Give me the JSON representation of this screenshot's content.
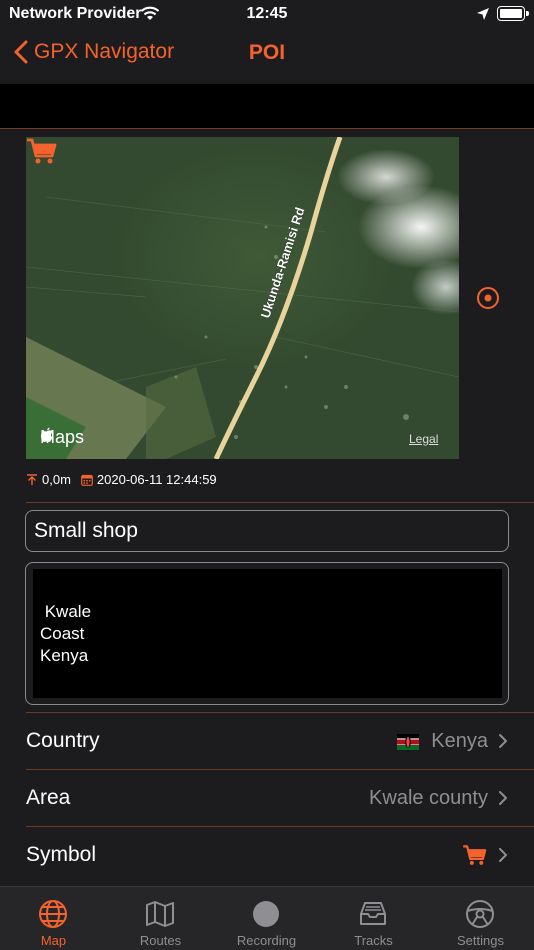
{
  "status_bar": {
    "carrier": "Network Provider",
    "time": "12:45",
    "icons": [
      "wifi-icon",
      "location-arrow-icon",
      "battery-icon"
    ]
  },
  "nav": {
    "back_label": "GPX Navigator",
    "title": "POI"
  },
  "map": {
    "road_label": "Ukunda-Ramisi Rd",
    "logo_text": "Maps",
    "legal_label": "Legal",
    "pin_icon": "shopping-cart-icon"
  },
  "meta": {
    "elevation": "0,0m",
    "timestamp": "2020-06-11 12:44:59"
  },
  "poi": {
    "name": "Small shop",
    "description": " Kwale\nCoast\nKenya"
  },
  "rows": {
    "country": {
      "label": "Country",
      "value": "Kenya",
      "icon": "kenya-flag-icon"
    },
    "area": {
      "label": "Area",
      "value": "Kwale county"
    },
    "symbol": {
      "label": "Symbol",
      "icon": "shopping-cart-icon"
    }
  },
  "tabs": [
    {
      "label": "Map",
      "icon": "globe-icon",
      "active": true
    },
    {
      "label": "Routes",
      "icon": "map-icon",
      "active": false
    },
    {
      "label": "Recording",
      "icon": "record-icon",
      "active": false
    },
    {
      "label": "Tracks",
      "icon": "inbox-icon",
      "active": false
    },
    {
      "label": "Settings",
      "icon": "steering-wheel-icon",
      "active": false
    }
  ],
  "colors": {
    "accent": "#f4622d",
    "background": "#1c1c1e",
    "separator": "#6e3a28",
    "secondary_text": "#8e8e93"
  }
}
